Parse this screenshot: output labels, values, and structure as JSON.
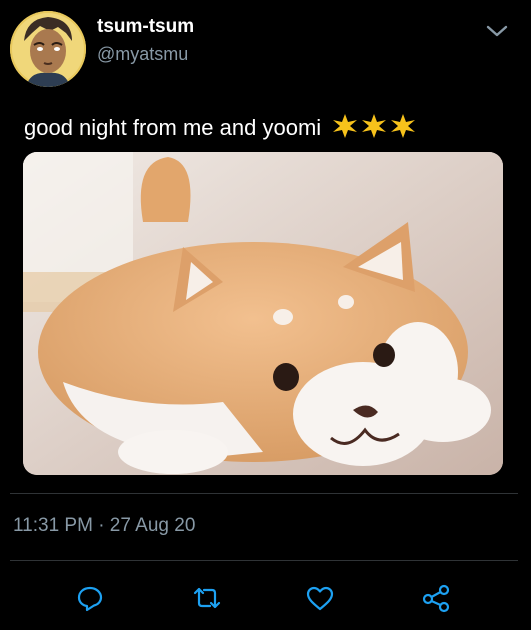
{
  "tweet": {
    "display_name": "tsum-tsum",
    "handle": "@myatsmu",
    "text": "good night from me and yoomi",
    "sparkle_icons": [
      "sparkle-icon",
      "sparkle-icon",
      "sparkle-icon"
    ],
    "photo": "shiba-inu-plush-photo",
    "timestamp": "11:31 PM · 27 Aug 20"
  },
  "actions": [
    "reply-icon",
    "retweet-icon",
    "like-icon",
    "share-icon"
  ],
  "colors": {
    "background": "#000000",
    "secondary_text": "#8899a6",
    "accent": "#1da1f2",
    "sparkle": "#f7c21b"
  }
}
